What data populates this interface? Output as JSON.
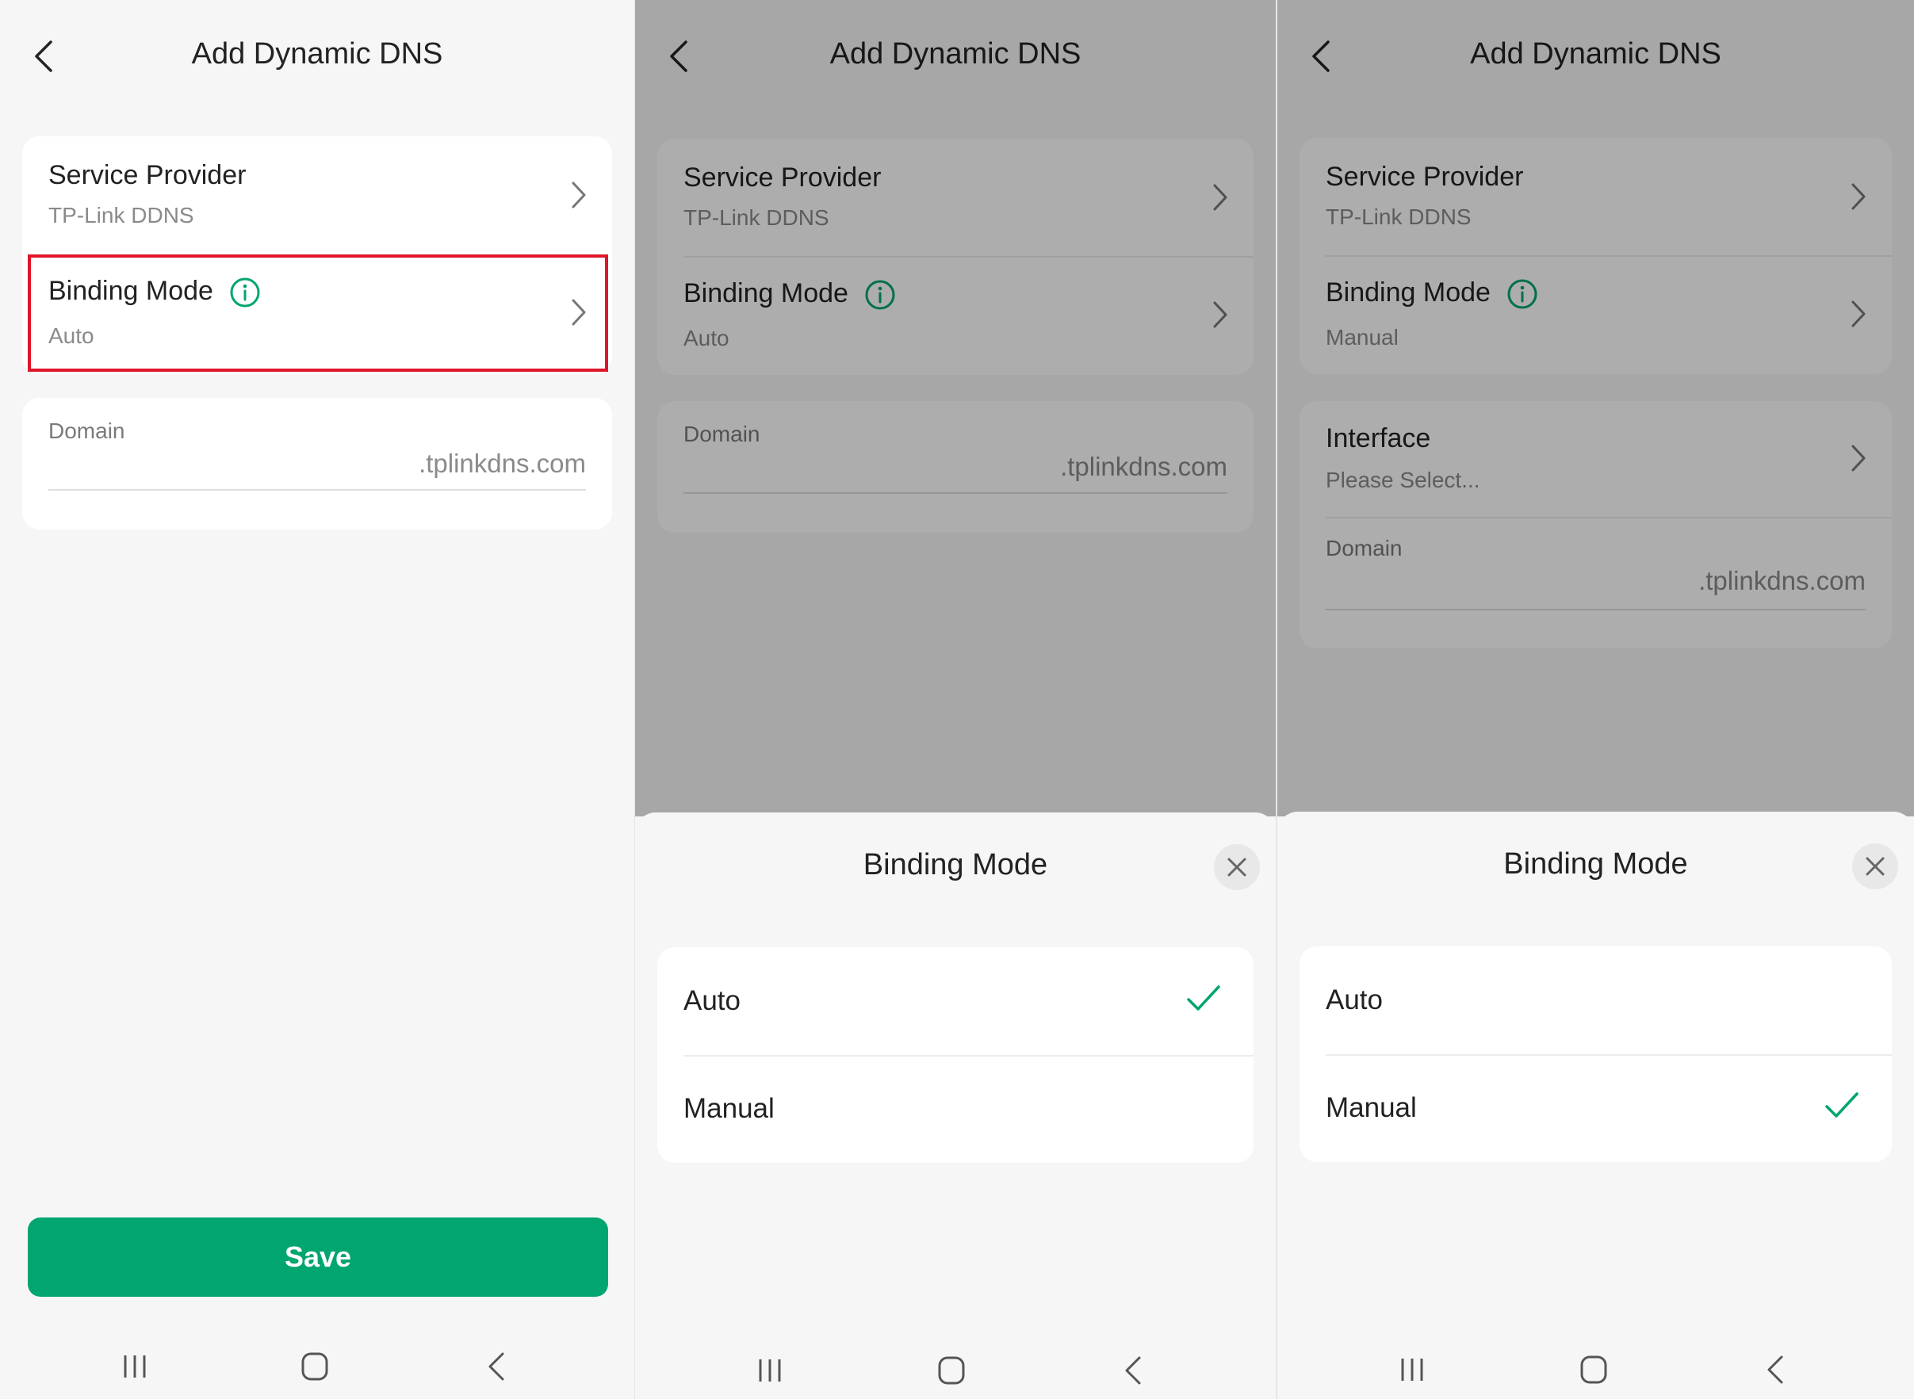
{
  "colors": {
    "accent": "#00a56f",
    "highlight": "#e0152a",
    "text": "#222222",
    "subtext": "#8a8a8a"
  },
  "header": {
    "title": "Add Dynamic DNS"
  },
  "labels": {
    "service_provider": "Service Provider",
    "binding_mode": "Binding Mode",
    "interface": "Interface",
    "domain": "Domain"
  },
  "values": {
    "service_provider": "TP-Link DDNS",
    "domain_suffix": ".tplinkdns.com",
    "interface_placeholder": "Please Select..."
  },
  "screens": [
    {
      "binding_mode": "Auto",
      "save_label": "Save"
    },
    {
      "binding_mode": "Auto",
      "sheet_title": "Binding Mode",
      "options": [
        "Auto",
        "Manual"
      ],
      "selected": "Auto"
    },
    {
      "binding_mode": "Manual",
      "sheet_title": "Binding Mode",
      "options": [
        "Auto",
        "Manual"
      ],
      "selected": "Manual"
    }
  ],
  "icons": {
    "back": "chevron-left-icon",
    "next": "chevron-right-icon",
    "info": "info-icon",
    "close": "close-icon",
    "check": "checkmark-icon",
    "nav": [
      "recent-apps-icon",
      "home-icon",
      "back-nav-icon"
    ]
  }
}
